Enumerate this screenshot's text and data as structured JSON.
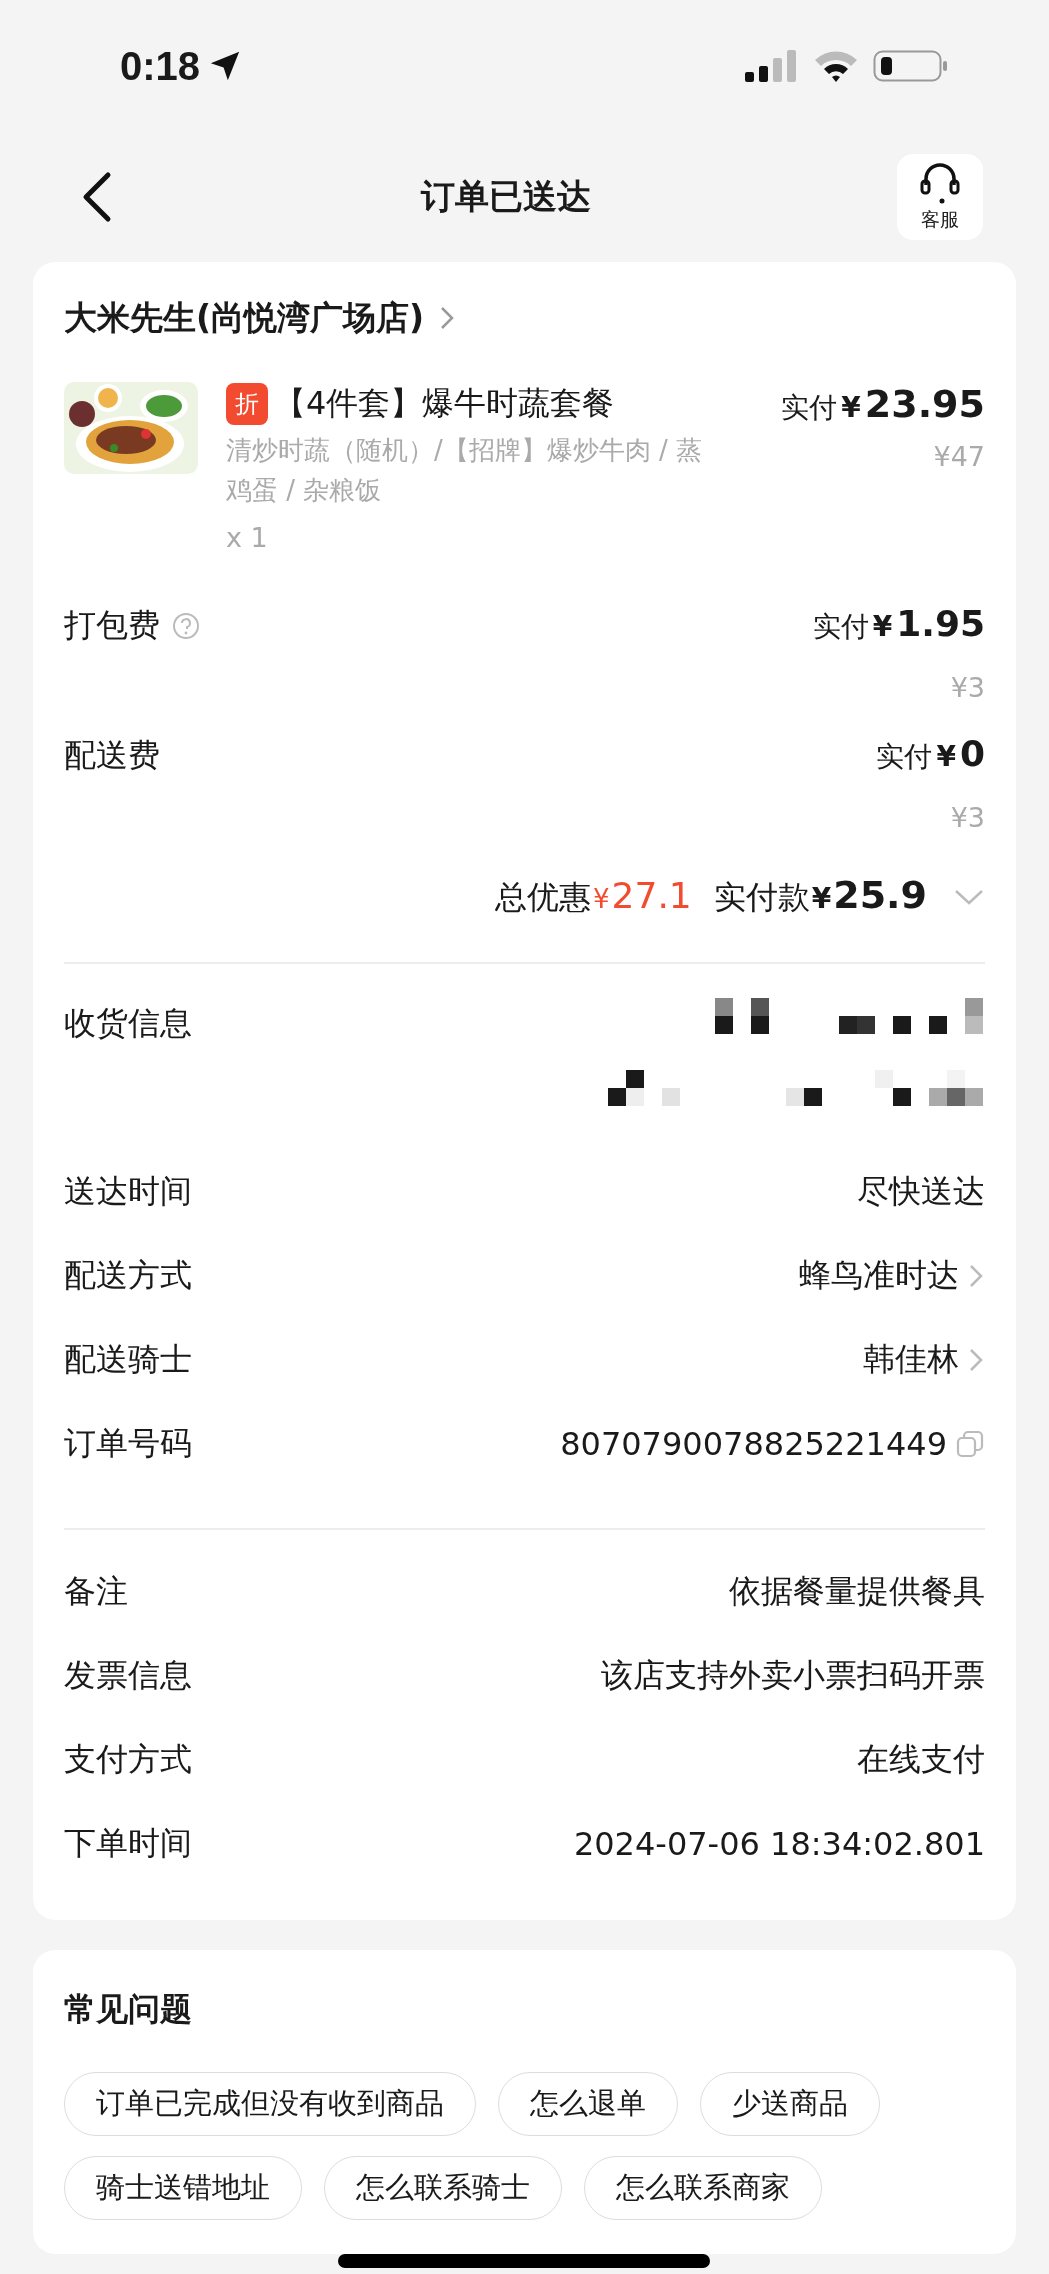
{
  "status_bar": {
    "time": "0:18"
  },
  "nav": {
    "title": "订单已送达",
    "service_label": "客服"
  },
  "store": {
    "name": "大米先生(尚悦湾广场店)"
  },
  "items": [
    {
      "discount_tag": "折",
      "name": "【4件套】爆牛时蔬套餐",
      "spec": "清炒时蔬（随机）/【招牌】爆炒牛肉 / 蒸鸡蛋 / 杂粮饭",
      "quantity": "x 1",
      "paid_label": "实付",
      "currency": "¥",
      "amount": "23.95",
      "original_price": "¥47"
    }
  ],
  "fees": [
    {
      "label": "打包费",
      "help": true,
      "paid_label": "实付",
      "currency": "¥",
      "amount": "1.95",
      "original_price": "¥3"
    },
    {
      "label": "配送费",
      "help": false,
      "paid_label": "实付",
      "currency": "¥",
      "amount": "0",
      "original_price": "¥3"
    }
  ],
  "summary": {
    "discount_label": "总优惠",
    "discount_currency": "¥",
    "discount_amount": "27.1",
    "paid_label": "实付款",
    "currency": "¥",
    "amount": "25.9"
  },
  "info_groups": [
    [
      {
        "label": "收货信息",
        "kind": "redacted"
      },
      {
        "label": "送达时间",
        "kind": "text",
        "value": "尽快送达"
      },
      {
        "label": "配送方式",
        "kind": "link",
        "value": "蜂鸟准时达"
      },
      {
        "label": "配送骑士",
        "kind": "link",
        "value": "韩佳林"
      },
      {
        "label": "订单号码",
        "kind": "copy",
        "value": "8070790078825221449"
      }
    ],
    [
      {
        "label": "备注",
        "kind": "text",
        "value": "依据餐量提供餐具"
      },
      {
        "label": "发票信息",
        "kind": "text",
        "value": "该店支持外卖小票扫码开票"
      },
      {
        "label": "支付方式",
        "kind": "text",
        "value": "在线支付"
      },
      {
        "label": "下单时间",
        "kind": "text",
        "value": "2024-07-06 18:34:02.801"
      }
    ]
  ],
  "faq": {
    "title": "常见问题",
    "questions": [
      "订单已完成但没有收到商品",
      "怎么退单",
      "少送商品",
      "骑士送错地址",
      "怎么联系骑士",
      "怎么联系商家"
    ]
  }
}
